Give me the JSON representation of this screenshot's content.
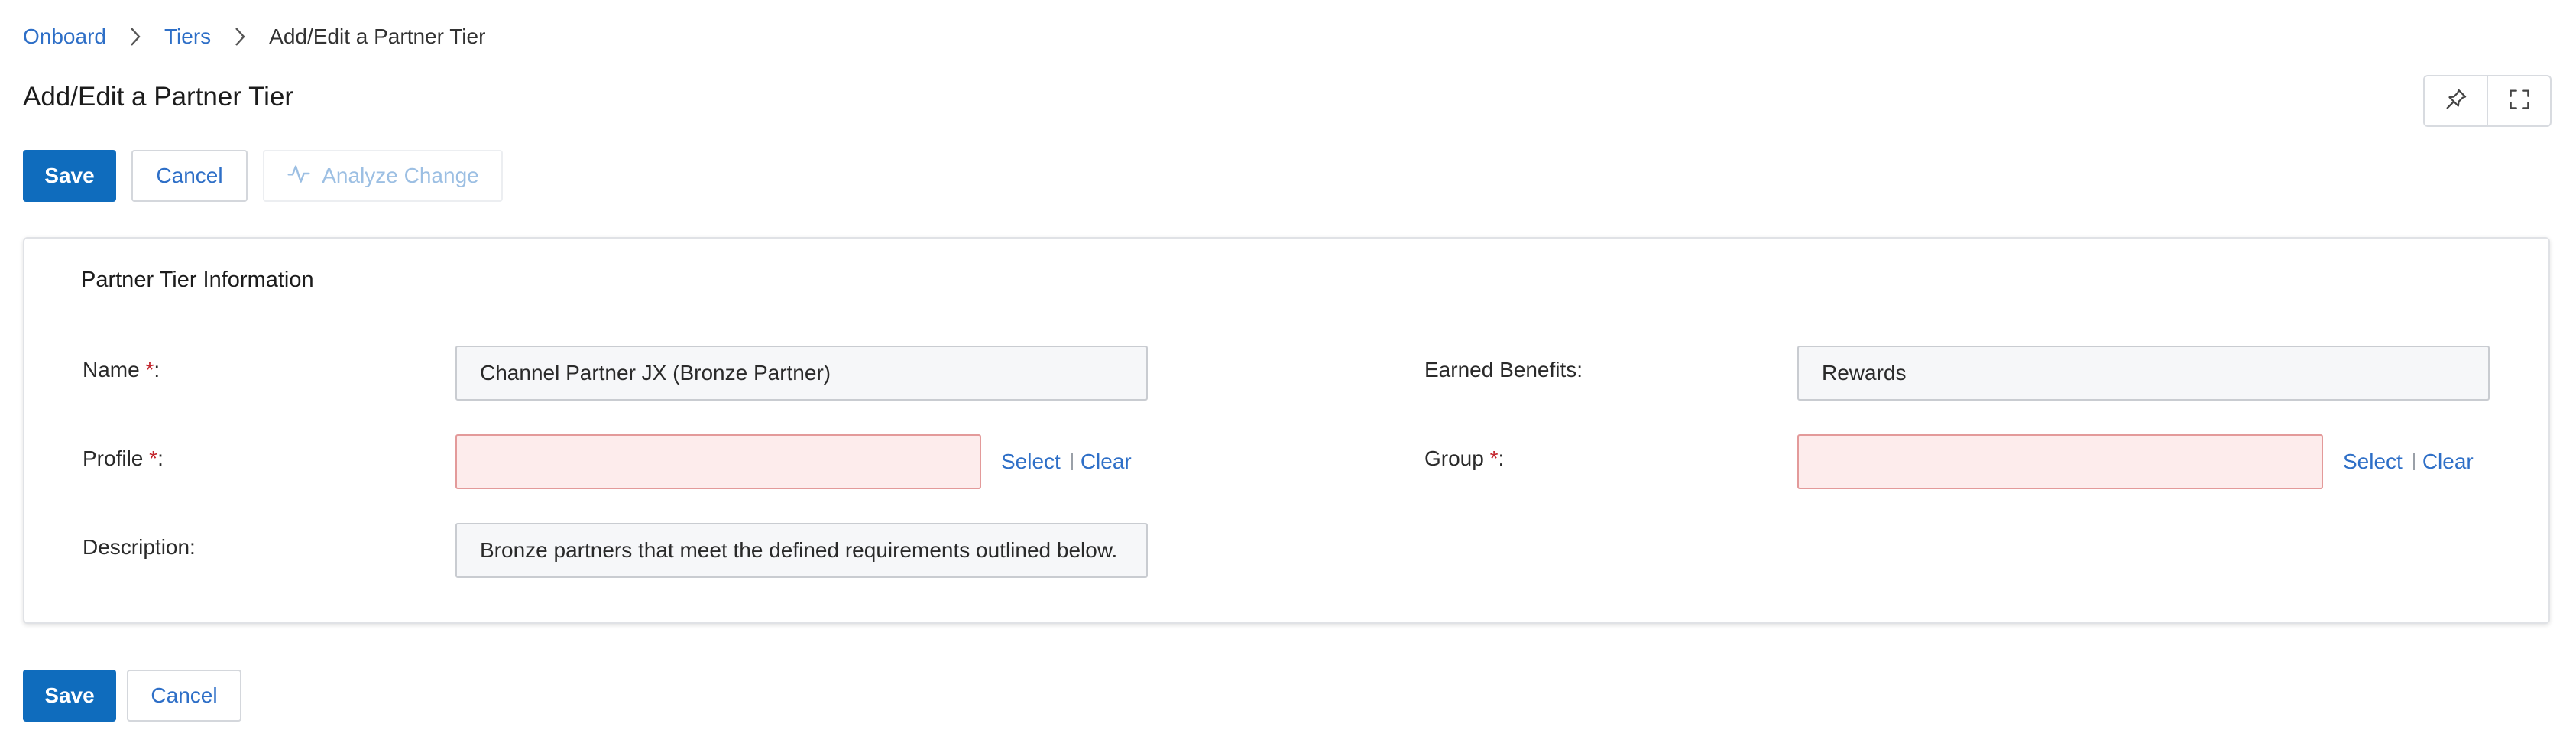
{
  "breadcrumb": {
    "items": [
      "Onboard",
      "Tiers"
    ],
    "current": "Add/Edit a Partner Tier"
  },
  "page": {
    "title": "Add/Edit a Partner Tier"
  },
  "toolbar": {
    "save_label": "Save",
    "cancel_label": "Cancel",
    "analyze_label": "Analyze Change",
    "pin_icon": "pin-icon",
    "expand_icon": "expand-icon"
  },
  "section": {
    "title": "Partner Tier Information",
    "required_marker": "*",
    "fields": {
      "name": {
        "label": "Name",
        "suffix": ":",
        "value": "Channel Partner JX (Bronze Partner)"
      },
      "earned_benefits": {
        "label": "Earned Benefits:",
        "value": "Rewards"
      },
      "profile": {
        "label": "Profile",
        "suffix": ":",
        "value": "",
        "select_label": "Select",
        "clear_label": "Clear"
      },
      "group": {
        "label": "Group",
        "suffix": ":",
        "value": "",
        "select_label": "Select",
        "clear_label": "Clear"
      },
      "description": {
        "label": "Description:",
        "value": "Bronze partners that meet the defined requirements outlined below."
      }
    }
  },
  "footer": {
    "save_label": "Save",
    "cancel_label": "Cancel"
  },
  "colors": {
    "primary": "#0f6cbd",
    "link": "#2e6fc7",
    "required": "#c4262e",
    "invalid_background": "#fdecec"
  }
}
